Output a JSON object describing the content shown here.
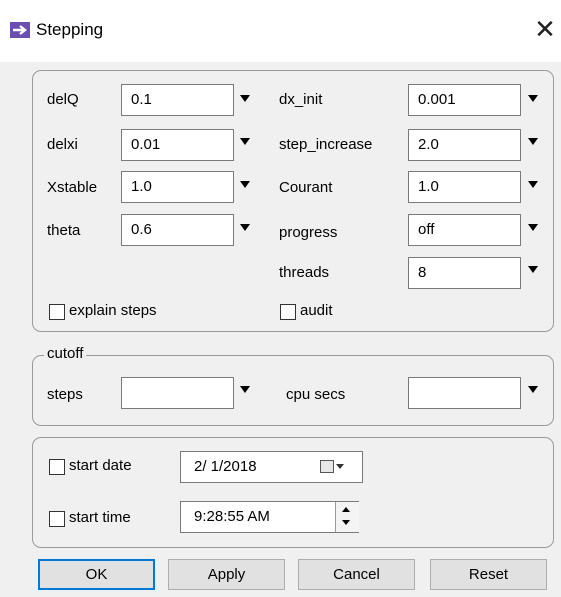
{
  "window": {
    "title": "Stepping",
    "close_glyph": "✕",
    "icon": "arrow-right-icon",
    "icon_color": "#6a4fb0"
  },
  "params": {
    "delQ": {
      "label": "delQ",
      "value": "0.1"
    },
    "delxi": {
      "label": "delxi",
      "value": "0.01"
    },
    "Xstable": {
      "label": "Xstable",
      "value": "1.0"
    },
    "theta": {
      "label": "theta",
      "value": "0.6"
    },
    "dx_init": {
      "label": "dx_init",
      "value": "0.001"
    },
    "step_increase": {
      "label": "step_increase",
      "value": "2.0"
    },
    "Courant": {
      "label": "Courant",
      "value": "1.0"
    },
    "progress": {
      "label": "progress",
      "value": "off"
    },
    "threads": {
      "label": "threads",
      "value": "8"
    },
    "explain_steps": {
      "label": "explain steps",
      "checked": false
    },
    "audit": {
      "label": "audit",
      "checked": false
    }
  },
  "cutoff": {
    "legend": "cutoff",
    "steps": {
      "label": "steps",
      "value": ""
    },
    "cpu_secs": {
      "label": "cpu secs",
      "value": ""
    }
  },
  "start": {
    "date": {
      "label": "start date",
      "checked": false,
      "value": "2/ 1/2018",
      "icon": "calendar-icon"
    },
    "time": {
      "label": "start time",
      "checked": false,
      "value": "9:28:55 AM"
    }
  },
  "buttons": {
    "ok": "OK",
    "apply": "Apply",
    "cancel": "Cancel",
    "reset": "Reset"
  },
  "colors": {
    "accent": "#0078d7",
    "panel": "#f0f0f0"
  }
}
